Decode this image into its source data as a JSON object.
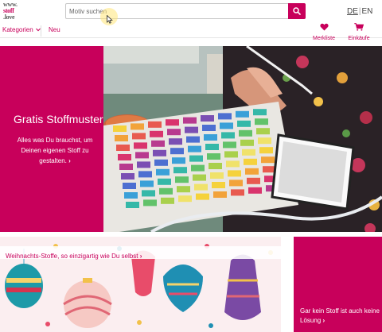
{
  "header": {
    "logo_lines": [
      "www.",
      "stoff",
      ".love"
    ],
    "search": {
      "placeholder": "Motiv suchen",
      "value": ""
    },
    "lang": {
      "de": "DE",
      "separator": "|",
      "en": "EN"
    },
    "icons": {
      "search": "search-icon"
    }
  },
  "nav": {
    "categories_label": "Kategorien",
    "new_label": "Neu",
    "wishlist_label": "Merkliste",
    "cart_label": "Einkäufe"
  },
  "hero": {
    "title": "Gratis Stoffmuster",
    "subtitle": "Alles was Du brauchst, um Deinen eigenen Stoff zu gestalten.",
    "chevron": "›"
  },
  "tiles": {
    "christmas_label": "Weihnachts-Stoffe, so einzigartig wie Du selbst",
    "christmas_chevron": "›",
    "no_fabric_label": "Gar kein Stoff ist auch keine Lösung",
    "no_fabric_chevron": "›"
  },
  "colors": {
    "brand": "#c8005b",
    "text": "#333333"
  }
}
